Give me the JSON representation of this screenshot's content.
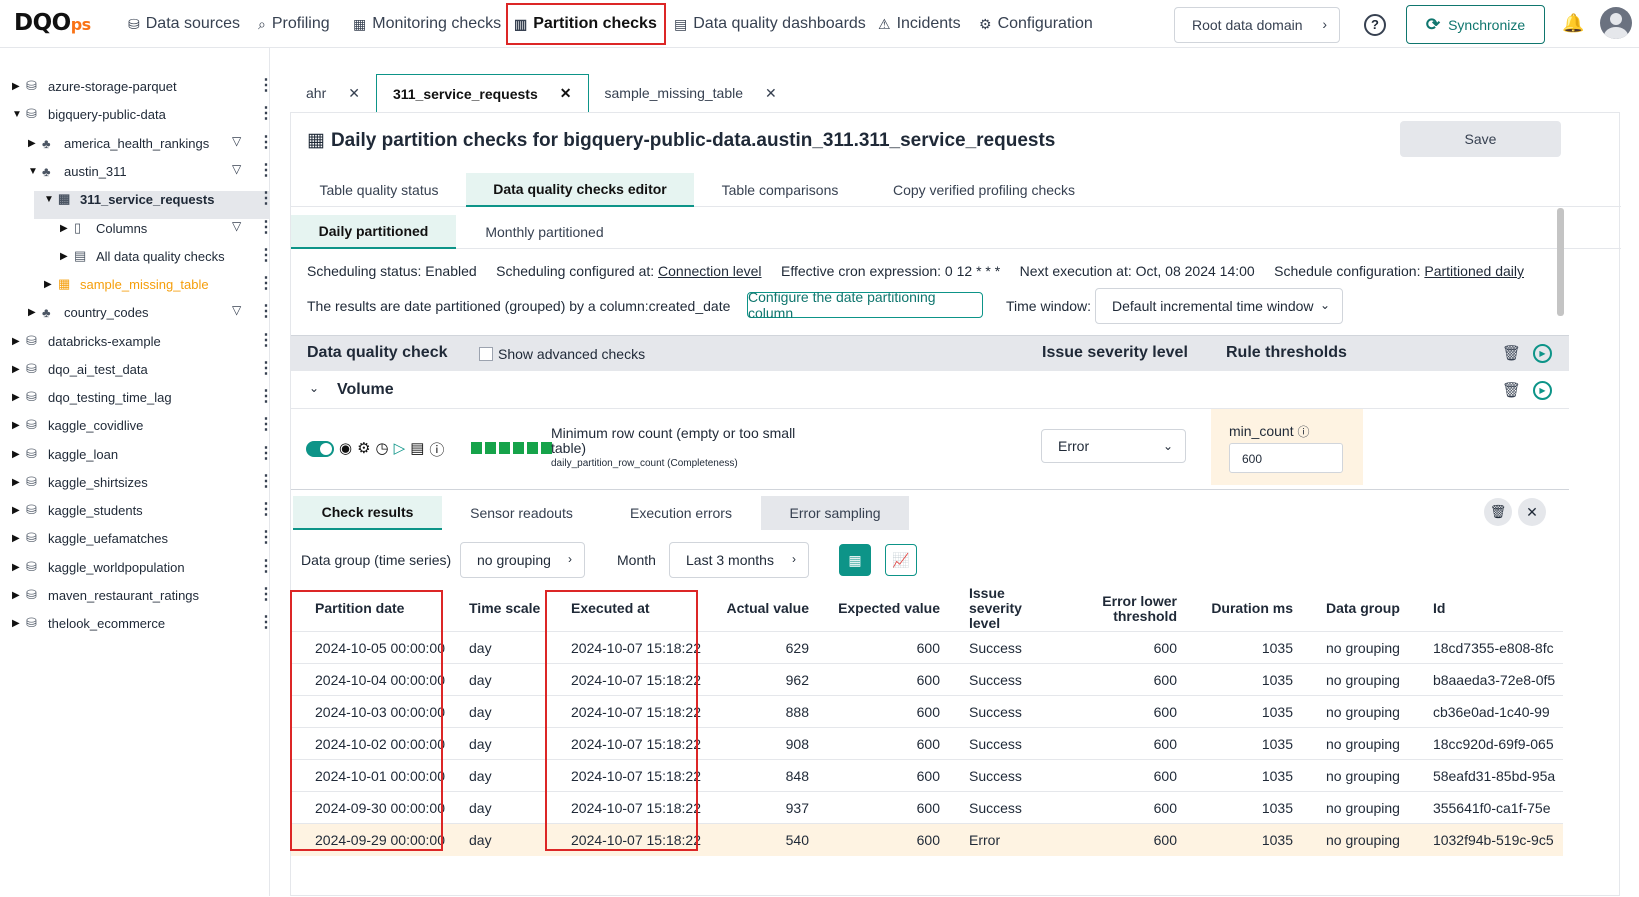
{
  "app": {
    "logo_main": "DQO",
    "logo_sub": "ps"
  },
  "nav": [
    {
      "label": "Data sources",
      "icon": "database-icon"
    },
    {
      "label": "Profiling",
      "icon": "profiling-icon"
    },
    {
      "label": "Monitoring checks",
      "icon": "monitoring-icon"
    },
    {
      "label": "Partition checks",
      "icon": "partition-icon"
    },
    {
      "label": "Data quality dashboards",
      "icon": "dashboard-icon"
    },
    {
      "label": "Incidents",
      "icon": "warning-icon"
    },
    {
      "label": "Configuration",
      "icon": "gear-icon"
    }
  ],
  "domain": {
    "label": "Root data domain"
  },
  "sync": {
    "label": "Synchronize"
  },
  "tree": [
    "azure-storage-parquet",
    "bigquery-public-data",
    "america_health_rankings",
    "austin_311",
    "311_service_requests",
    "Columns",
    "All data quality checks",
    "sample_missing_table",
    "country_codes",
    "databricks-example",
    "dqo_ai_test_data",
    "dqo_testing_time_lag",
    "kaggle_covidlive",
    "kaggle_loan",
    "kaggle_shirtsizes",
    "kaggle_students",
    "kaggle_uefamatches",
    "kaggle_worldpopulation",
    "maven_restaurant_ratings",
    "thelook_ecommerce"
  ],
  "file_tabs": [
    "ahr",
    "311_service_requests",
    "sample_missing_table"
  ],
  "panel": {
    "title": "Daily partition checks for bigquery-public-data.austin_311.311_service_requests",
    "save": "Save",
    "subtabs": [
      "Table quality status",
      "Data quality checks editor",
      "Table comparisons",
      "Copy verified profiling checks"
    ],
    "modetabs": [
      "Daily partitioned",
      "Monthly partitioned"
    ],
    "scheduling_status": "Scheduling status: Enabled",
    "configured_at_label": "Scheduling configured at:",
    "configured_at_value": "Connection level",
    "cron": "Effective cron expression: 0 12 * * *",
    "next_exec": "Next execution at: Oct, 08 2024 14:00",
    "schedule_cfg_label": "Schedule configuration:",
    "schedule_cfg_value": "Partitioned daily",
    "partition_text": "The results are date partitioned (grouped) by a column:created_date",
    "configure_btn": "Configure the date partitioning column",
    "time_window_label": "Time window:",
    "time_window_value": "Default incremental time window"
  },
  "checks_header": {
    "col1": "Data quality check",
    "advanced": "Show advanced checks",
    "col2": "Issue severity level",
    "col3": "Rule thresholds"
  },
  "category": "Volume",
  "check": {
    "name": "Minimum row count (empty or too small table)",
    "sub": "daily_partition_row_count (Completeness)",
    "severity": "Error",
    "threshold_label": "min_count",
    "threshold_value": "600"
  },
  "results": {
    "tabs": [
      "Check results",
      "Sensor readouts",
      "Execution errors",
      "Error sampling"
    ],
    "data_group_label": "Data group (time series)",
    "data_group_value": "no grouping",
    "month_label": "Month",
    "month_value": "Last 3 months",
    "columns": [
      "Partition date",
      "Time scale",
      "Executed at",
      "Actual value",
      "Expected value",
      "Issue severity level",
      "Error lower threshold",
      "Duration ms",
      "Data group",
      "Id"
    ],
    "rows": [
      [
        "2024-10-05 00:00:00",
        "day",
        "2024-10-07 15:18:22",
        "629",
        "600",
        "Success",
        "600",
        "1035",
        "no grouping",
        "18cd7355-e808-8fc"
      ],
      [
        "2024-10-04 00:00:00",
        "day",
        "2024-10-07 15:18:22",
        "962",
        "600",
        "Success",
        "600",
        "1035",
        "no grouping",
        "b8aaeda3-72e8-0f5"
      ],
      [
        "2024-10-03 00:00:00",
        "day",
        "2024-10-07 15:18:22",
        "888",
        "600",
        "Success",
        "600",
        "1035",
        "no grouping",
        "cb36e0ad-1c40-99"
      ],
      [
        "2024-10-02 00:00:00",
        "day",
        "2024-10-07 15:18:22",
        "908",
        "600",
        "Success",
        "600",
        "1035",
        "no grouping",
        "18cc920d-69f9-065"
      ],
      [
        "2024-10-01 00:00:00",
        "day",
        "2024-10-07 15:18:22",
        "848",
        "600",
        "Success",
        "600",
        "1035",
        "no grouping",
        "58eafd31-85bd-95a"
      ],
      [
        "2024-09-30 00:00:00",
        "day",
        "2024-10-07 15:18:22",
        "937",
        "600",
        "Success",
        "600",
        "1035",
        "no grouping",
        "355641f0-ca1f-75e"
      ],
      [
        "2024-09-29 00:00:00",
        "day",
        "2024-10-07 15:18:22",
        "540",
        "600",
        "Error",
        "600",
        "1035",
        "no grouping",
        "1032f94b-519c-9c5"
      ]
    ]
  },
  "colors": {
    "accent": "#0d9488",
    "highlight": "#dc2626",
    "error_row": "#fef3e2",
    "tree_selected": "#f59e0b"
  }
}
